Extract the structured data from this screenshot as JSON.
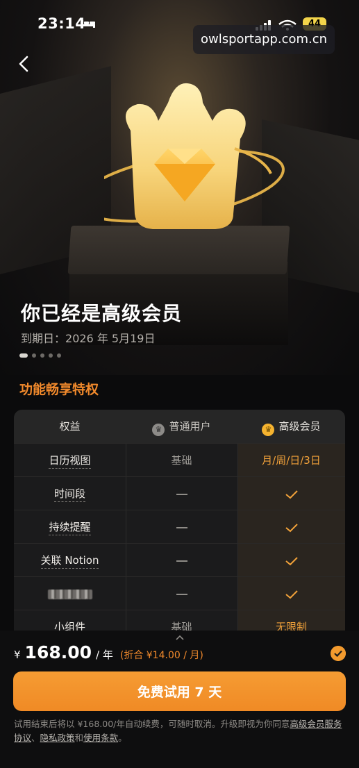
{
  "status_bar": {
    "time": "23:14",
    "battery": "44"
  },
  "watermark": "owlsportapp.com.cn",
  "hero": {
    "title": "你已经是高级会员",
    "expiry_label": "到期日：",
    "expiry_date": "2026 年 5月19日",
    "carousel": {
      "count": 5,
      "active": 0
    }
  },
  "section_title": "功能畅享特权",
  "table": {
    "headers": {
      "benefit": "权益",
      "normal": "普通用户",
      "premium": "高级会员"
    },
    "rows": [
      {
        "name": "日历视图",
        "normal": "基础",
        "premium": "月/周/日/3日"
      },
      {
        "name": "时间段",
        "normal": "—",
        "premium": "✓"
      },
      {
        "name": "持续提醒",
        "normal": "—",
        "premium": "✓"
      },
      {
        "name": "关联 Notion",
        "normal": "—",
        "premium": "✓"
      },
      {
        "name": "",
        "normal": "—",
        "premium": "✓"
      },
      {
        "name": "小组件",
        "normal": "基础",
        "premium": "无限制"
      }
    ]
  },
  "purchase": {
    "currency": "¥",
    "price": "168.00",
    "period": "/ 年",
    "discount": "(折合 ¥14.00 / 月)",
    "cta": "免费试用 7 天",
    "terms_text": "试用结束后将以 ¥168.00/年自动续费，可随时取消。升级即视为你同意",
    "terms_link_1": "高级会员服务协议",
    "sep_1": "、",
    "terms_link_2": "隐私政策",
    "sep_2": "和",
    "terms_link_3": "使用条款",
    "end": "。"
  },
  "colors": {
    "accent": "#f28a2c",
    "gold": "#f5b32f",
    "background": "#0b0b0c"
  }
}
